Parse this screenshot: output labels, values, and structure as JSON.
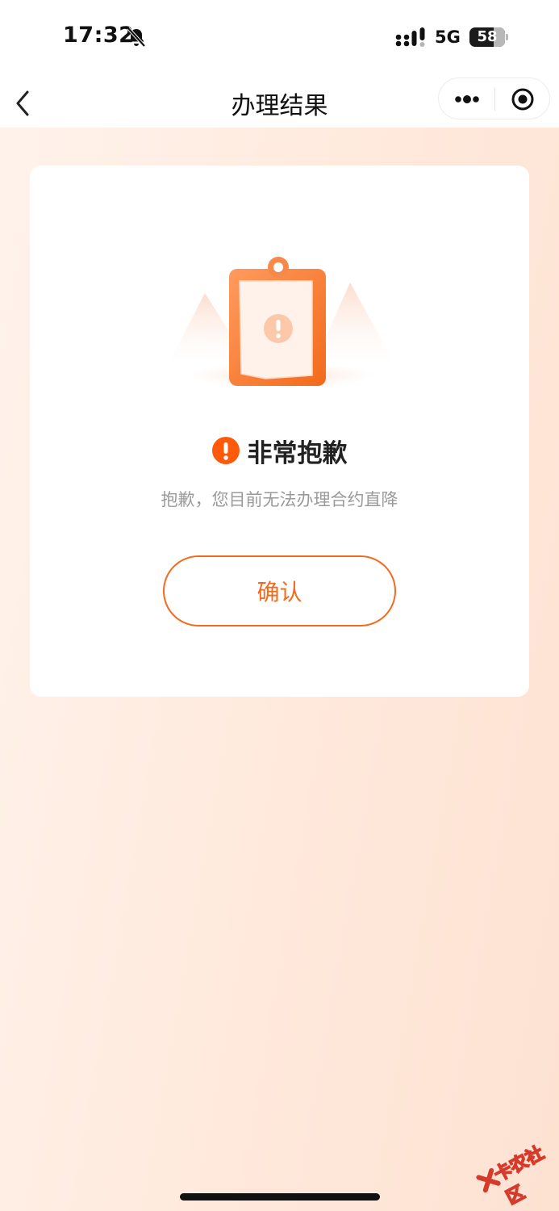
{
  "status_bar": {
    "time": "17:32",
    "network": "5G",
    "battery": "58",
    "icons": [
      "bell-mute-icon",
      "signal-icon",
      "battery-icon"
    ]
  },
  "nav": {
    "title": "办理结果",
    "icons": [
      "back-arrow-icon",
      "more-dots-icon",
      "close-circle-icon"
    ]
  },
  "result": {
    "illustration": "clipboard-warning-illustration",
    "title": "非常抱歉",
    "description": "抱歉，您目前无法办理合约直降",
    "confirm_label": "确认"
  },
  "watermark": {
    "text": "卡农社区"
  },
  "colors": {
    "accent": "#f26a1b",
    "warning": "#ff5a0a",
    "background_start": "#fff3ec",
    "background_end": "#fde2d2",
    "card": "#ffffff"
  }
}
